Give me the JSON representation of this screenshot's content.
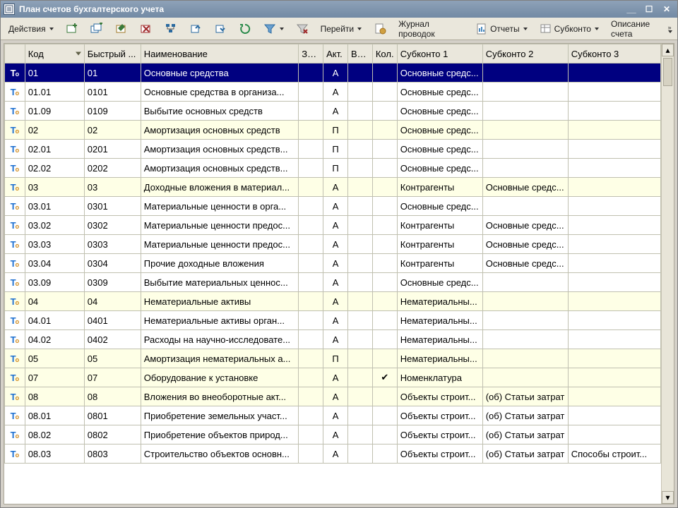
{
  "window": {
    "title": "План счетов бухгалтерского учета"
  },
  "toolbar": {
    "actions": "Действия",
    "goto": "Перейти",
    "journal": "Журнал проводок",
    "reports": "Отчеты",
    "subkonto": "Субконто",
    "description": "Описание счета"
  },
  "columns": {
    "icon": "",
    "code": "Код",
    "quick": "Быстрый ...",
    "name": "Наименование",
    "zab": "Заб.",
    "akt": "Акт.",
    "val": "Вал.",
    "kol": "Кол.",
    "sub1": "Субконто 1",
    "sub2": "Субконто 2",
    "sub3": "Субконто 3"
  },
  "rows": [
    {
      "sel": true,
      "tint": false,
      "code": "01",
      "quick": "01",
      "name": "Основные средства",
      "akt": "А",
      "kol": "",
      "sub1": "Основные средс...",
      "sub2": "",
      "sub3": ""
    },
    {
      "sel": false,
      "tint": false,
      "code": "01.01",
      "quick": "0101",
      "name": "Основные средства в организа...",
      "akt": "А",
      "kol": "",
      "sub1": "Основные средс...",
      "sub2": "",
      "sub3": ""
    },
    {
      "sel": false,
      "tint": false,
      "code": "01.09",
      "quick": "0109",
      "name": "Выбытие основных средств",
      "akt": "А",
      "kol": "",
      "sub1": "Основные средс...",
      "sub2": "",
      "sub3": ""
    },
    {
      "sel": false,
      "tint": true,
      "code": "02",
      "quick": "02",
      "name": "Амортизация основных средств",
      "akt": "П",
      "kol": "",
      "sub1": "Основные средс...",
      "sub2": "",
      "sub3": ""
    },
    {
      "sel": false,
      "tint": false,
      "code": "02.01",
      "quick": "0201",
      "name": "Амортизация основных средств...",
      "akt": "П",
      "kol": "",
      "sub1": "Основные средс...",
      "sub2": "",
      "sub3": ""
    },
    {
      "sel": false,
      "tint": false,
      "code": "02.02",
      "quick": "0202",
      "name": "Амортизация основных средств...",
      "akt": "П",
      "kol": "",
      "sub1": "Основные средс...",
      "sub2": "",
      "sub3": ""
    },
    {
      "sel": false,
      "tint": true,
      "code": "03",
      "quick": "03",
      "name": "Доходные вложения в материал...",
      "akt": "А",
      "kol": "",
      "sub1": "Контрагенты",
      "sub2": "Основные средс...",
      "sub3": ""
    },
    {
      "sel": false,
      "tint": false,
      "code": "03.01",
      "quick": "0301",
      "name": "Материальные ценности в орга...",
      "akt": "А",
      "kol": "",
      "sub1": "Основные средс...",
      "sub2": "",
      "sub3": ""
    },
    {
      "sel": false,
      "tint": false,
      "code": "03.02",
      "quick": "0302",
      "name": "Материальные ценности предос...",
      "akt": "А",
      "kol": "",
      "sub1": "Контрагенты",
      "sub2": "Основные средс...",
      "sub3": ""
    },
    {
      "sel": false,
      "tint": false,
      "code": "03.03",
      "quick": "0303",
      "name": "Материальные ценности предос...",
      "akt": "А",
      "kol": "",
      "sub1": "Контрагенты",
      "sub2": "Основные средс...",
      "sub3": ""
    },
    {
      "sel": false,
      "tint": false,
      "code": "03.04",
      "quick": "0304",
      "name": "Прочие доходные вложения",
      "akt": "А",
      "kol": "",
      "sub1": "Контрагенты",
      "sub2": "Основные средс...",
      "sub3": ""
    },
    {
      "sel": false,
      "tint": false,
      "code": "03.09",
      "quick": "0309",
      "name": "Выбытие материальных ценнос...",
      "akt": "А",
      "kol": "",
      "sub1": "Основные средс...",
      "sub2": "",
      "sub3": ""
    },
    {
      "sel": false,
      "tint": true,
      "code": "04",
      "quick": "04",
      "name": "Нематериальные активы",
      "akt": "А",
      "kol": "",
      "sub1": "Нематериальны...",
      "sub2": "",
      "sub3": ""
    },
    {
      "sel": false,
      "tint": false,
      "code": "04.01",
      "quick": "0401",
      "name": "Нематериальные активы орган...",
      "akt": "А",
      "kol": "",
      "sub1": "Нематериальны...",
      "sub2": "",
      "sub3": ""
    },
    {
      "sel": false,
      "tint": false,
      "code": "04.02",
      "quick": "0402",
      "name": "Расходы на научно-исследовате...",
      "akt": "А",
      "kol": "",
      "sub1": "Нематериальны...",
      "sub2": "",
      "sub3": ""
    },
    {
      "sel": false,
      "tint": true,
      "code": "05",
      "quick": "05",
      "name": "Амортизация нематериальных а...",
      "akt": "П",
      "kol": "",
      "sub1": "Нематериальны...",
      "sub2": "",
      "sub3": ""
    },
    {
      "sel": false,
      "tint": true,
      "code": "07",
      "quick": "07",
      "name": "Оборудование к установке",
      "akt": "А",
      "kol": "✔",
      "sub1": "Номенклатура",
      "sub2": "",
      "sub3": ""
    },
    {
      "sel": false,
      "tint": true,
      "code": "08",
      "quick": "08",
      "name": "Вложения во внеоборотные акт...",
      "akt": "А",
      "kol": "",
      "sub1": "Объекты строит...",
      "sub2": "(об) Статьи затрат",
      "sub3": ""
    },
    {
      "sel": false,
      "tint": false,
      "code": "08.01",
      "quick": "0801",
      "name": "Приобретение земельных участ...",
      "akt": "А",
      "kol": "",
      "sub1": "Объекты строит...",
      "sub2": "(об) Статьи затрат",
      "sub3": ""
    },
    {
      "sel": false,
      "tint": false,
      "code": "08.02",
      "quick": "0802",
      "name": "Приобретение объектов природ...",
      "akt": "А",
      "kol": "",
      "sub1": "Объекты строит...",
      "sub2": "(об) Статьи затрат",
      "sub3": ""
    },
    {
      "sel": false,
      "tint": false,
      "code": "08.03",
      "quick": "0803",
      "name": "Строительство объектов основн...",
      "akt": "А",
      "kol": "",
      "sub1": "Объекты строит...",
      "sub2": "(об) Статьи затрат",
      "sub3": "Способы строит..."
    }
  ]
}
